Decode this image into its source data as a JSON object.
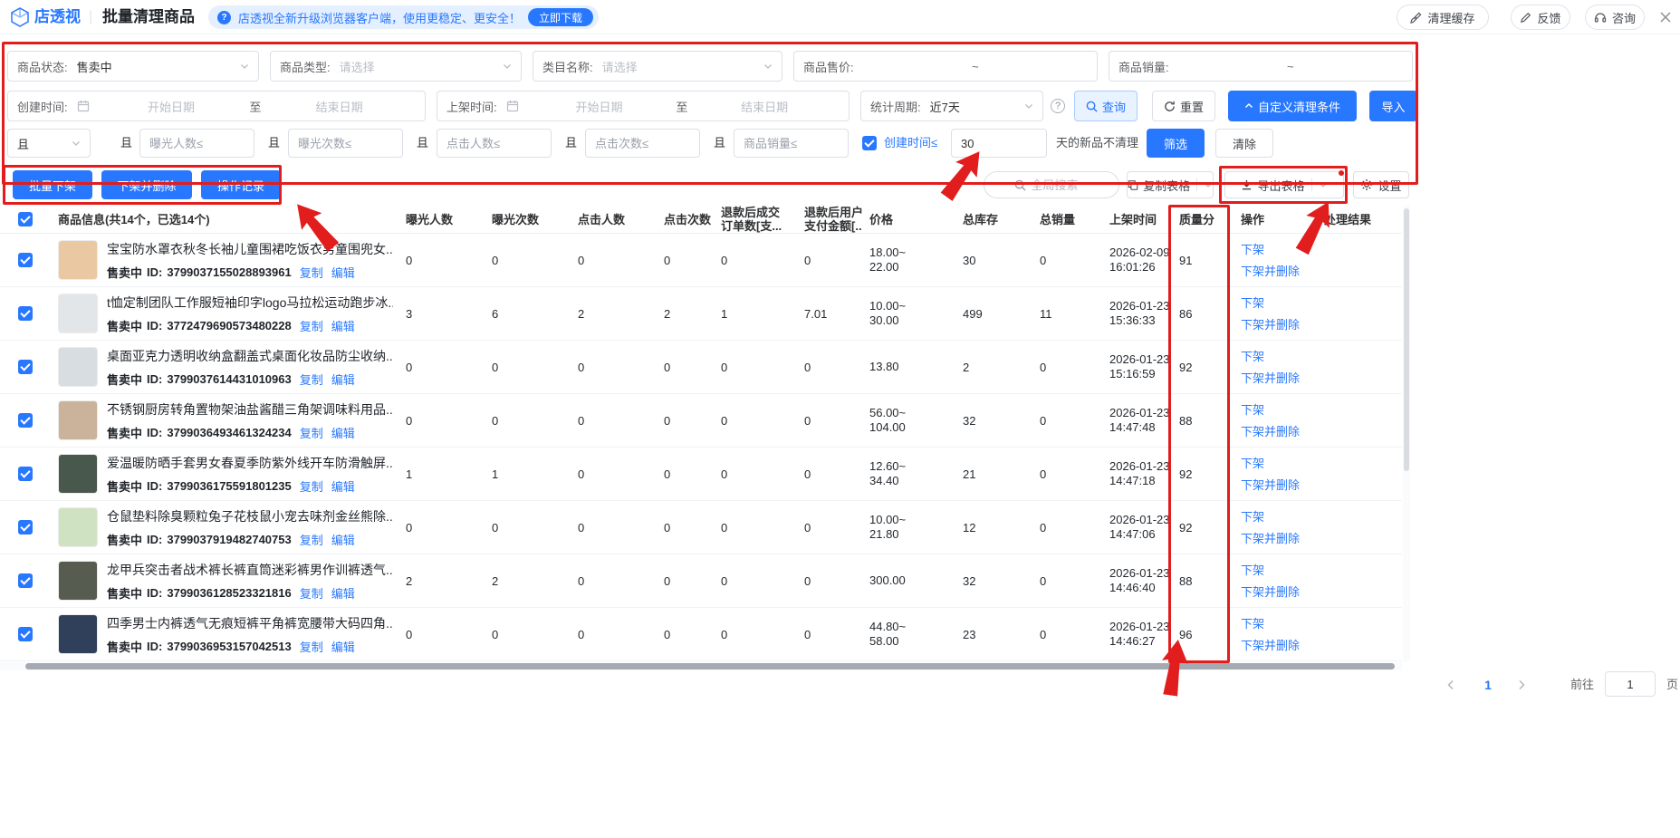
{
  "colors": {
    "accent": "#2878ff",
    "annotation_red": "#e21d1d"
  },
  "icons": {
    "question_mark": "?"
  },
  "topbar": {
    "logo_text": "店透视",
    "divider": "|",
    "page_title": "批量清理商品",
    "banner": {
      "text": "店透视全新升级浏览器客户端，使用更稳定、更安全！",
      "button": "立即下载"
    },
    "actions": [
      {
        "label": "清理缓存"
      },
      {
        "label": "反馈"
      },
      {
        "label": "咨询"
      }
    ]
  },
  "filters": {
    "row1": [
      {
        "label": "商品状态:",
        "value": "售卖中"
      },
      {
        "label": "商品类型:",
        "value": "请选择"
      },
      {
        "label": "类目名称:",
        "value": "请选择"
      },
      {
        "label": "商品售价:",
        "separator": "~"
      },
      {
        "label": "商品销量:",
        "separator": "~"
      }
    ],
    "row2": {
      "create_time_label": "创建时间:",
      "shelf_time_label": "上架时间:",
      "date_start_placeholder": "开始日期",
      "date_to": "至",
      "date_end_placeholder": "结束日期",
      "stat_period_label": "统计周期:",
      "stat_period_value": "近7天",
      "query_button": "查询",
      "reset_button": "重置",
      "custom_button": "自定义清理条件",
      "import_button": "导入"
    },
    "row3": {
      "and_select": "且",
      "and_label": "且",
      "inputs": [
        "曝光人数≤",
        "曝光次数≤",
        "点击人数≤",
        "点击次数≤",
        "商品销量≤"
      ],
      "newitem_checkbox_label": "创建时间≤",
      "newitem_value": "30",
      "newitem_suffix": "天的新品不清理",
      "filter_button": "筛选",
      "clear_button": "清除"
    }
  },
  "toolbar": {
    "batch_offshelf": "批量下架",
    "offshelf_delete": "下架并删除",
    "operation_log": "操作记录",
    "search_placeholder": "全局搜索",
    "copy_table": "复制表格",
    "export_table": "导出表格",
    "settings": "设置"
  },
  "table": {
    "headers": {
      "info": "商品信息(共14个，已选14个)",
      "exposure_people": "曝光人数",
      "exposure_views": "曝光次数",
      "click_people": "点击人数",
      "click_views": "点击次数",
      "refund_orders_l1": "退款后成交",
      "refund_orders_l2": "订单数[支...",
      "refund_amount_l1": "退款后用户",
      "refund_amount_l2": "支付金额[...",
      "price": "价格",
      "stock": "总库存",
      "sales": "总销量",
      "shelf_time": "上架时间",
      "quality": "质量分",
      "actions": "操作",
      "result": "处理结果"
    },
    "row_labels": {
      "status": "售卖中",
      "id_label": "ID:",
      "copy": "复制",
      "edit": "编辑",
      "offshelf": "下架",
      "offshelf_delete": "下架并删除"
    },
    "rows": [
      {
        "title": "宝宝防水罩衣秋冬长袖儿童围裙吃饭衣男童围兜女...",
        "id": "3799037155028893961",
        "thumb": "#eac9a2",
        "exposure_people": "0",
        "exposure_views": "0",
        "click_people": "0",
        "click_views": "0",
        "refund_orders": "0",
        "refund_amount": "0",
        "price_l1": "18.00~",
        "price_l2": "22.00",
        "stock": "30",
        "sales": "0",
        "date": "2026-02-09",
        "time": "16:01:26",
        "quality": "91"
      },
      {
        "title": "t恤定制团队工作服短袖印字logo马拉松运动跑步冰...",
        "id": "3772479690573480228",
        "thumb": "#e3e6e9",
        "exposure_people": "3",
        "exposure_views": "6",
        "click_people": "2",
        "click_views": "2",
        "refund_orders": "1",
        "refund_amount": "7.01",
        "price_l1": "10.00~",
        "price_l2": "30.00",
        "stock": "499",
        "sales": "11",
        "date": "2026-01-23",
        "time": "15:36:33",
        "quality": "86"
      },
      {
        "title": "桌面亚克力透明收纳盒翻盖式桌面化妆品防尘收纳...",
        "id": "3799037614431010963",
        "thumb": "#d8dde2",
        "exposure_people": "0",
        "exposure_views": "0",
        "click_people": "0",
        "click_views": "0",
        "refund_orders": "0",
        "refund_amount": "0",
        "price_l1": "13.80",
        "price_l2": "",
        "stock": "2",
        "sales": "0",
        "date": "2026-01-23",
        "time": "15:16:59",
        "quality": "92"
      },
      {
        "title": "不锈钢厨房转角置物架油盐酱醋三角架调味料用品...",
        "id": "3799036493461324234",
        "thumb": "#cbb39b",
        "exposure_people": "0",
        "exposure_views": "0",
        "click_people": "0",
        "click_views": "0",
        "refund_orders": "0",
        "refund_amount": "0",
        "price_l1": "56.00~",
        "price_l2": "104.00",
        "stock": "32",
        "sales": "0",
        "date": "2026-01-23",
        "time": "14:47:48",
        "quality": "88"
      },
      {
        "title": "爱温暖防晒手套男女春夏季防紫外线开车防滑触屏...",
        "id": "3799036175591801235",
        "thumb": "#49584c",
        "exposure_people": "1",
        "exposure_views": "1",
        "click_people": "0",
        "click_views": "0",
        "refund_orders": "0",
        "refund_amount": "0",
        "price_l1": "12.60~",
        "price_l2": "34.40",
        "stock": "21",
        "sales": "0",
        "date": "2026-01-23",
        "time": "14:47:18",
        "quality": "92"
      },
      {
        "title": "仓鼠垫料除臭颗粒兔子花枝鼠小宠去味剂金丝熊除...",
        "id": "3799037919482740753",
        "thumb": "#cfe3c2",
        "exposure_people": "0",
        "exposure_views": "0",
        "click_people": "0",
        "click_views": "0",
        "refund_orders": "0",
        "refund_amount": "0",
        "price_l1": "10.00~",
        "price_l2": "21.80",
        "stock": "12",
        "sales": "0",
        "date": "2026-01-23",
        "time": "14:47:06",
        "quality": "92"
      },
      {
        "title": "龙甲兵突击者战术裤长裤直筒迷彩裤男作训裤透气...",
        "id": "3799036128523321816",
        "thumb": "#565d50",
        "exposure_people": "2",
        "exposure_views": "2",
        "click_people": "0",
        "click_views": "0",
        "refund_orders": "0",
        "refund_amount": "0",
        "price_l1": "300.00",
        "price_l2": "",
        "stock": "32",
        "sales": "0",
        "date": "2026-01-23",
        "time": "14:46:40",
        "quality": "88"
      },
      {
        "title": "四季男士内裤透气无痕短裤平角裤宽腰带大码四角...",
        "id": "3799036953157042513",
        "thumb": "#31405a",
        "exposure_people": "0",
        "exposure_views": "0",
        "click_people": "0",
        "click_views": "0",
        "refund_orders": "0",
        "refund_amount": "0",
        "price_l1": "44.80~",
        "price_l2": "58.00",
        "stock": "23",
        "sales": "0",
        "date": "2026-01-23",
        "time": "14:46:27",
        "quality": "96"
      }
    ]
  },
  "pagination": {
    "current": "1",
    "goto_label": "前往",
    "goto_value": "1",
    "page_unit": "页"
  }
}
